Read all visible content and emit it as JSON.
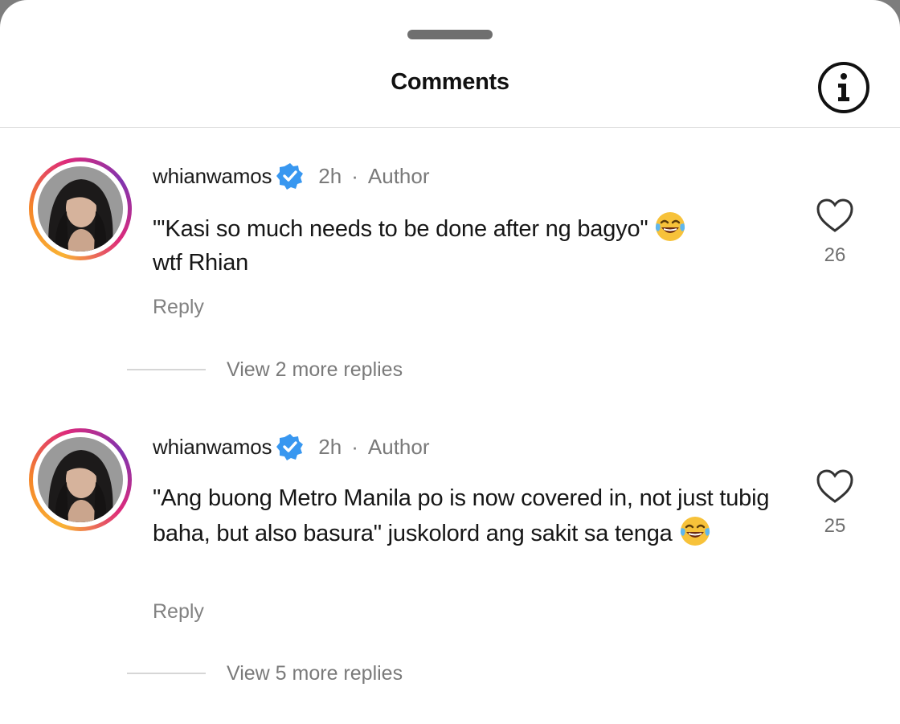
{
  "header": {
    "title": "Comments"
  },
  "icons": {
    "info": "info-icon",
    "verified": "verified-badge-icon",
    "like": "heart-icon",
    "emoji": "laughing-tears-emoji"
  },
  "colors": {
    "verified_blue": "#3897f0",
    "muted_text": "#7a7a7a",
    "story_ring": [
      "#f9b234",
      "#f58529",
      "#dd2a7b",
      "#8134af"
    ]
  },
  "comments": [
    {
      "username": "whianwamos",
      "time": "2h",
      "role": "Author",
      "text": "\"'Kasi so much needs to be done after ng bagyo\"",
      "text_tail": "wtf Rhian",
      "like_count": "26",
      "reply_label": "Reply",
      "view_replies_label": "View 2 more replies"
    },
    {
      "username": "whianwamos",
      "time": "2h",
      "role": "Author",
      "text": "\"Ang buong Metro Manila po is now covered in, not just tubig baha, but also basura\" juskolord ang sakit sa tenga",
      "like_count": "25",
      "reply_label": "Reply",
      "view_replies_label": "View 5 more replies"
    }
  ]
}
